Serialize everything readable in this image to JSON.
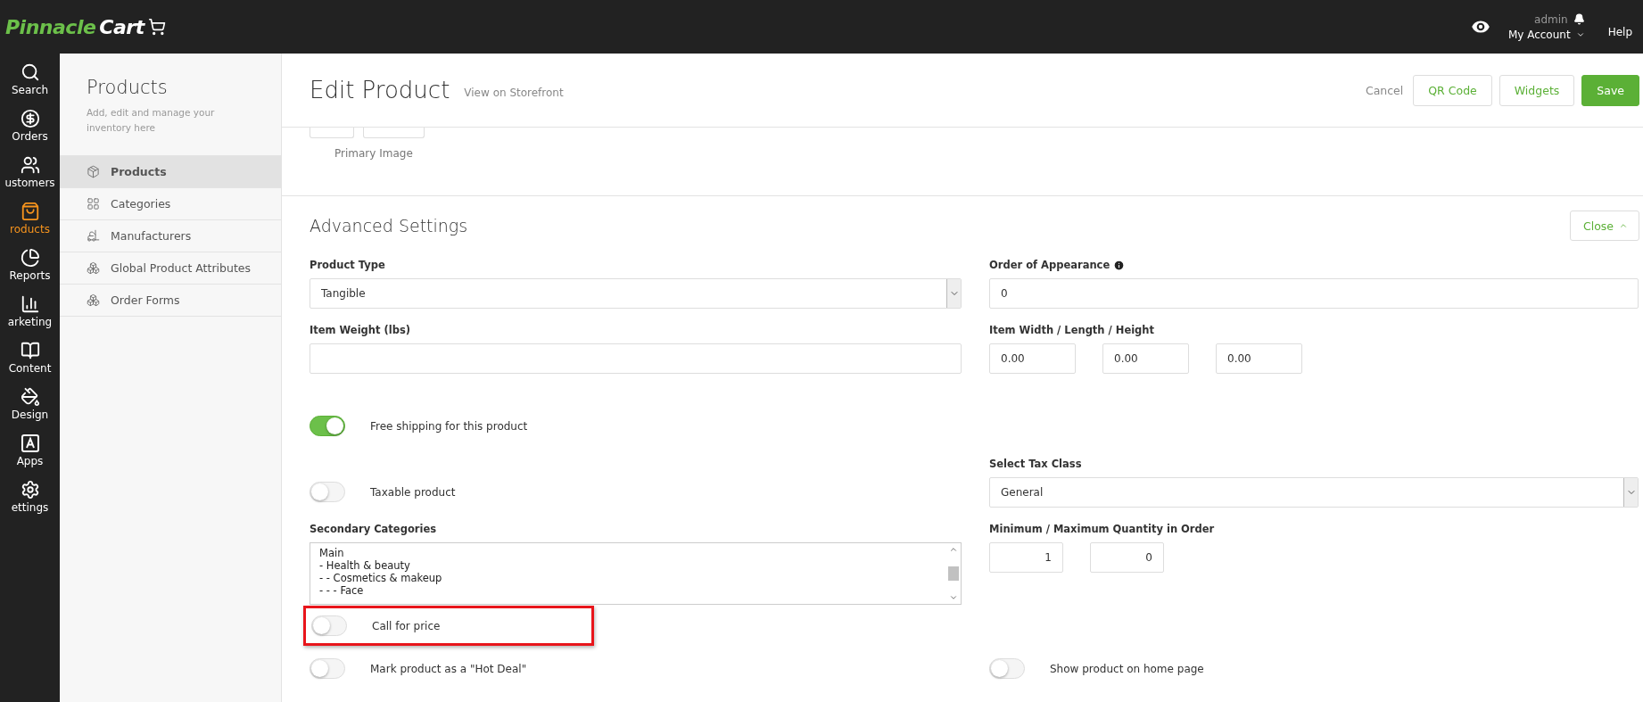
{
  "app": {
    "logo_primary": "Pinnacle",
    "logo_secondary": "Cart"
  },
  "top_bar": {
    "user": "admin",
    "account": "My Account",
    "help": "Help"
  },
  "nav": [
    {
      "label": "Search",
      "selected": false
    },
    {
      "label": "Orders",
      "selected": false
    },
    {
      "label": "ustomers",
      "selected": false
    },
    {
      "label": "roducts",
      "selected": true
    },
    {
      "label": "Reports",
      "selected": false
    },
    {
      "label": "arketing",
      "selected": false
    },
    {
      "label": "Content",
      "selected": false
    },
    {
      "label": "Design",
      "selected": false
    },
    {
      "label": "Apps",
      "selected": false
    },
    {
      "label": "ettings",
      "selected": false
    }
  ],
  "sidebar": {
    "title": "Products",
    "description": "Add, edit and manage your inventory here",
    "items": [
      {
        "label": "Products",
        "selected": true
      },
      {
        "label": "Categories",
        "selected": false
      },
      {
        "label": "Manufacturers",
        "selected": false
      },
      {
        "label": "Global Product Attributes",
        "selected": false
      },
      {
        "label": "Order Forms",
        "selected": false
      }
    ]
  },
  "header": {
    "title": "Edit Product",
    "link": "View on Storefront",
    "actions": [
      {
        "label": "Cancel",
        "kind": "link"
      },
      {
        "label": "QR Code",
        "kind": "outline"
      },
      {
        "label": "Widgets",
        "kind": "outline"
      },
      {
        "label": "Save",
        "kind": "primary"
      }
    ]
  },
  "image_section": {
    "caption": "Primary Image"
  },
  "advanced": {
    "title": "Advanced Settings",
    "collapse_button": "Close",
    "product_type": {
      "label": "Product Type",
      "value": "Tangible"
    },
    "order_of_appearance": {
      "label": "Order of Appearance",
      "value": "0"
    },
    "item_weight": {
      "label": "Item Weight (lbs)"
    },
    "dimensions": {
      "label": "Item Width / Length / Height",
      "values": [
        "0.00",
        "0.00",
        "0.00"
      ]
    },
    "free_shipping": {
      "label": "Free shipping for this product",
      "on": true
    },
    "tax_class": {
      "label": "Select Tax Class",
      "value": "General"
    },
    "taxable": {
      "label": "Taxable product",
      "on": false
    },
    "secondary_categories": {
      "label": "Secondary Categories",
      "options": [
        "Main",
        "- Health & beauty",
        "- - Cosmetics & makeup",
        "- - - Face"
      ]
    },
    "quantity": {
      "label": "Minimum / Maximum Quantity in Order",
      "values": [
        "1",
        "0"
      ]
    },
    "call_for_price": {
      "label": "Call for price",
      "on": false,
      "highlighted": true
    },
    "hot_deal": {
      "label": "Mark product as a \"Hot Deal\"",
      "on": false
    },
    "home_page": {
      "label": "Show product on home page",
      "on": false
    }
  }
}
